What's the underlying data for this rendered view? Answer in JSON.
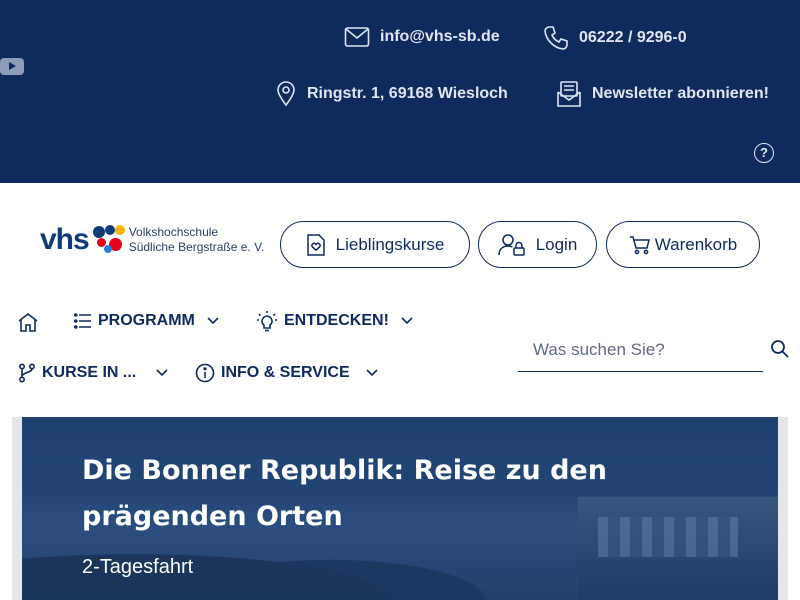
{
  "topbar": {
    "email": "info@vhs-sb.de",
    "phone": "06222 / 9296-0",
    "address": "Ringstr. 1, 69168 Wiesloch",
    "newsletter": "Newsletter abonnieren!",
    "help": "?",
    "background_color": "#0f2a5c"
  },
  "logo": {
    "mark": "vhs",
    "line1": "Volkshochschule",
    "line2": "Südliche Bergstraße e. V."
  },
  "header_buttons": {
    "favorites": "Lieblingskurse",
    "login": "Login",
    "cart": "Warenkorb"
  },
  "nav": {
    "programm": "PROGRAMM",
    "entdecken": "ENTDECKEN!",
    "kurse": "KURSE IN ...",
    "info": "INFO & SERVICE"
  },
  "search": {
    "placeholder": "Was suchen Sie?"
  },
  "hero": {
    "title": "Die Bonner Republik: Reise zu den prägenden Orten",
    "subtitle": "2-Tagesfahrt"
  }
}
